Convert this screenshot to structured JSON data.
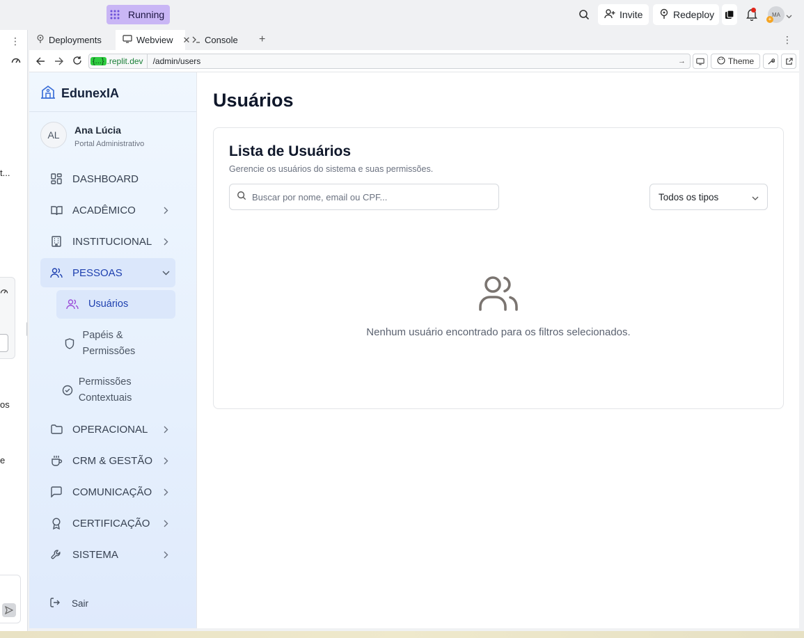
{
  "topbar": {
    "status_label": "Running",
    "invite_label": "Invite",
    "redeploy_label": "Redeploy",
    "avatar_initials": "MA",
    "avatar_badge": "+"
  },
  "left_panel": {
    "text_1": "t...",
    "text_2": "os",
    "text_3": "e"
  },
  "tabs": [
    {
      "label": "Deployments",
      "icon": "deploy-icon"
    },
    {
      "label": "Webview",
      "icon": "monitor-icon",
      "active": true
    },
    {
      "label": "Console",
      "icon": "terminal-icon"
    }
  ],
  "urlbar": {
    "host_badge": "{...}",
    "host_domain": ".replit.dev",
    "path": "/admin/users",
    "theme_label": "Theme"
  },
  "sidebar": {
    "brand": "EdunexIA",
    "user": {
      "initials": "AL",
      "name": "Ana Lúcia",
      "role": "Portal Administrativo"
    },
    "items": [
      {
        "label": "DASHBOARD"
      },
      {
        "label": "ACADÊMICO"
      },
      {
        "label": "INSTITUCIONAL"
      },
      {
        "label": "PESSOAS"
      },
      {
        "label": "OPERACIONAL"
      },
      {
        "label": "CRM & GESTÃO"
      },
      {
        "label": "COMUNICAÇÃO"
      },
      {
        "label": "CERTIFICAÇÃO"
      },
      {
        "label": "SISTEMA"
      }
    ],
    "subitems": [
      {
        "label": "Usuários"
      },
      {
        "label": "Papéis & Permissões"
      },
      {
        "label": "Permissões Contextuais"
      }
    ],
    "logout_label": "Sair"
  },
  "main": {
    "page_title": "Usuários",
    "card_title": "Lista de Usuários",
    "card_subtitle": "Gerencie os usuários do sistema e suas permissões.",
    "search_placeholder": "Buscar por nome, email ou CPF...",
    "filter_value": "Todos os tipos",
    "empty_message": "Nenhum usuário encontrado para os filtros selecionados."
  },
  "colors": {
    "accent": "#1e40af",
    "running": "#c9b6f5",
    "active_sub": "#7c3aed"
  }
}
